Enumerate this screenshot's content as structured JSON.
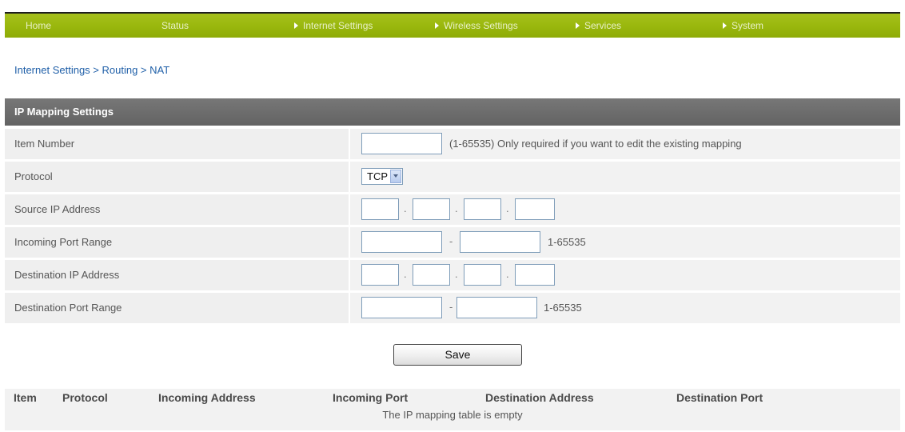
{
  "nav": {
    "items": [
      {
        "label": "Home"
      },
      {
        "label": "Status"
      },
      {
        "label": "Internet Settings"
      },
      {
        "label": "Wireless Settings"
      },
      {
        "label": "Services"
      },
      {
        "label": "System"
      }
    ]
  },
  "breadcrumb": "Internet Settings > Routing > NAT",
  "panel": {
    "title": "IP Mapping Settings",
    "rows": {
      "item_number": {
        "label": "Item Number",
        "value": "",
        "hint": "(1-65535)  Only required if you want to edit the existing mapping"
      },
      "protocol": {
        "label": "Protocol",
        "selected": "TCP"
      },
      "source_ip": {
        "label": "Source IP Address",
        "octets": [
          "",
          "",
          "",
          ""
        ],
        "separator": "."
      },
      "incoming_port": {
        "label": "Incoming Port Range",
        "from": "",
        "to": "",
        "dash": "-",
        "range_hint": "1-65535"
      },
      "destination_ip": {
        "label": "Destination IP Address",
        "octets": [
          "",
          "",
          "",
          ""
        ],
        "separator": "."
      },
      "destination_port": {
        "label": "Destination Port Range",
        "from": "",
        "to": "",
        "dash": "-",
        "range_hint": "1-65535"
      }
    }
  },
  "save_label": "Save",
  "table": {
    "columns": [
      "Item",
      "Protocol",
      "Incoming Address",
      "Incoming Port",
      "Destination Address",
      "Destination Port"
    ],
    "empty_message": "The IP mapping table is empty"
  },
  "colors": {
    "nav_green": "#9ab80e",
    "panel_header": "#6b6b6b",
    "link_blue": "#1f5fa8",
    "row_bg": "#efefef"
  },
  "icons": {
    "nav_arrow": "triangle-right-icon",
    "dropdown": "chevron-down-icon"
  }
}
